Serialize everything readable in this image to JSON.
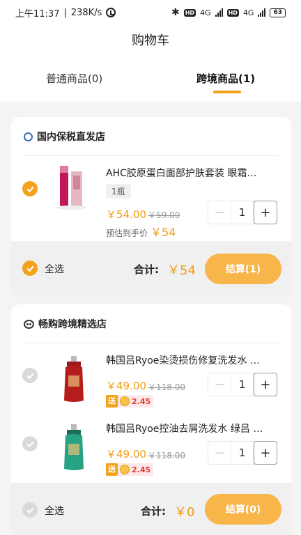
{
  "status_bar": {
    "time": "上午11:37",
    "speed": "238K/s",
    "battery": "63",
    "hd": "HD",
    "net": "4G"
  },
  "page": {
    "title": "购物车"
  },
  "tabs": [
    {
      "label": "普通商品(0)",
      "active": false
    },
    {
      "label": "跨境商品(1)",
      "active": true
    }
  ],
  "stores": [
    {
      "name": "国内保税直发店",
      "items": [
        {
          "name": "AHC胶原蛋白面部护肤套装 眼霜…",
          "spec": "1瓶",
          "price": "￥54.00",
          "original_price": "￥59.00",
          "estimate_label": "预估到手价",
          "estimate_value": "￥54",
          "quantity": "1",
          "checked": true
        }
      ],
      "footer": {
        "select_all": "全选",
        "total_label": "合计:",
        "total_value": "￥54",
        "checkout": "结算(1)",
        "checked": true
      }
    },
    {
      "name": "畅购跨境精选店",
      "items": [
        {
          "name": "韩国吕Ryoe染烫损伤修复洗发水 …",
          "price": "￥49.00",
          "original_price": "￥118.00",
          "promo_tag": "送",
          "promo_value": "2.45",
          "quantity": "1",
          "checked": false
        },
        {
          "name": "韩国吕Ryoe控油去屑洗发水 绿吕 …",
          "price": "￥49.00",
          "original_price": "￥118.00",
          "promo_tag": "送",
          "promo_value": "2.45",
          "quantity": "1",
          "checked": false
        }
      ],
      "footer": {
        "select_all": "全选",
        "total_label": "合计:",
        "total_value": "￥0",
        "checkout": "结算(0)",
        "checked": false
      }
    }
  ],
  "colors": {
    "accent": "#f3a21a",
    "price": "#f39c12",
    "promo_red": "#e53935"
  }
}
